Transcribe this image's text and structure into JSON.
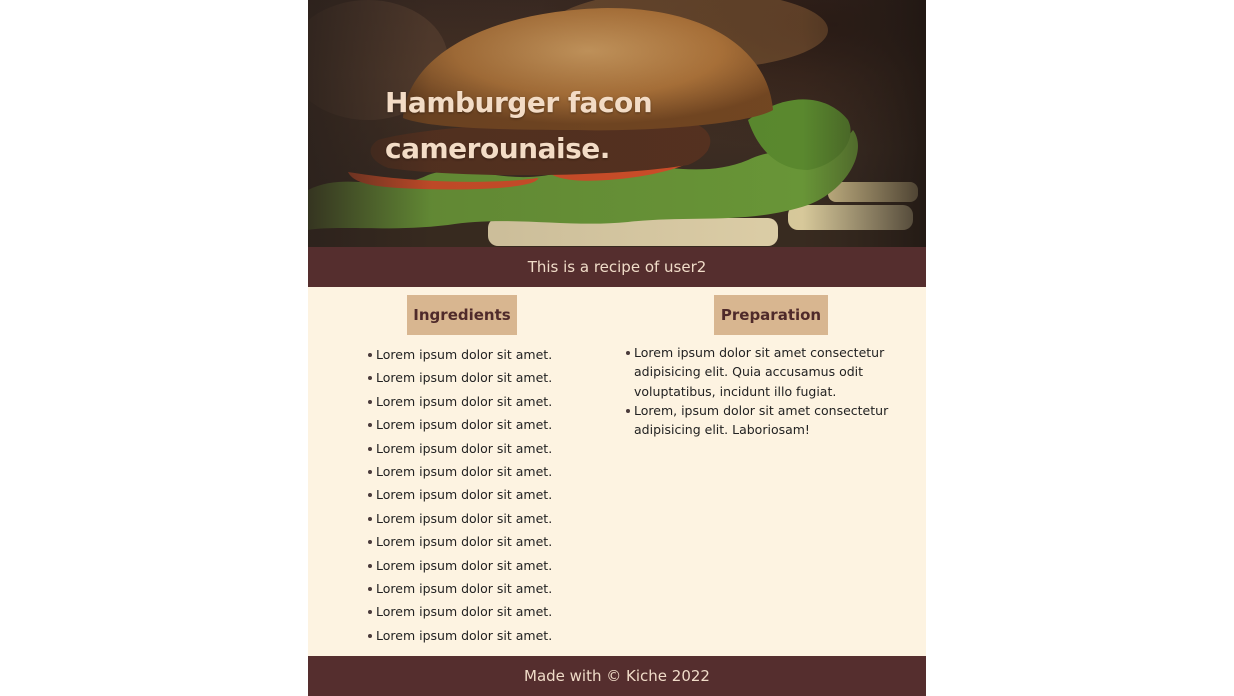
{
  "hero": {
    "title": "Hamburger facon camerounaise."
  },
  "byline": "This is a recipe of user2",
  "ingredients": {
    "heading": "Ingredients",
    "items": [
      "Lorem ipsum dolor sit amet.",
      "Lorem ipsum dolor sit amet.",
      "Lorem ipsum dolor sit amet.",
      "Lorem ipsum dolor sit amet.",
      "Lorem ipsum dolor sit amet.",
      "Lorem ipsum dolor sit amet.",
      "Lorem ipsum dolor sit amet.",
      "Lorem ipsum dolor sit amet.",
      "Lorem ipsum dolor sit amet.",
      "Lorem ipsum dolor sit amet.",
      "Lorem ipsum dolor sit amet.",
      "Lorem ipsum dolor sit amet.",
      "Lorem ipsum dolor sit amet."
    ]
  },
  "preparation": {
    "heading": "Preparation",
    "steps": [
      "Lorem ipsum dolor sit amet consectetur adipisicing elit. Quia accusamus odit voluptatibus, incidunt illo fugiat.",
      "Lorem, ipsum dolor sit amet consectetur adipisicing elit. Laboriosam!"
    ]
  },
  "footer": "Made with © Kiche 2022",
  "colors": {
    "band": "#552e2e",
    "page": "#fdf3e1",
    "heading_bg": "#d8b690",
    "heading_text": "#4f2a2a"
  }
}
